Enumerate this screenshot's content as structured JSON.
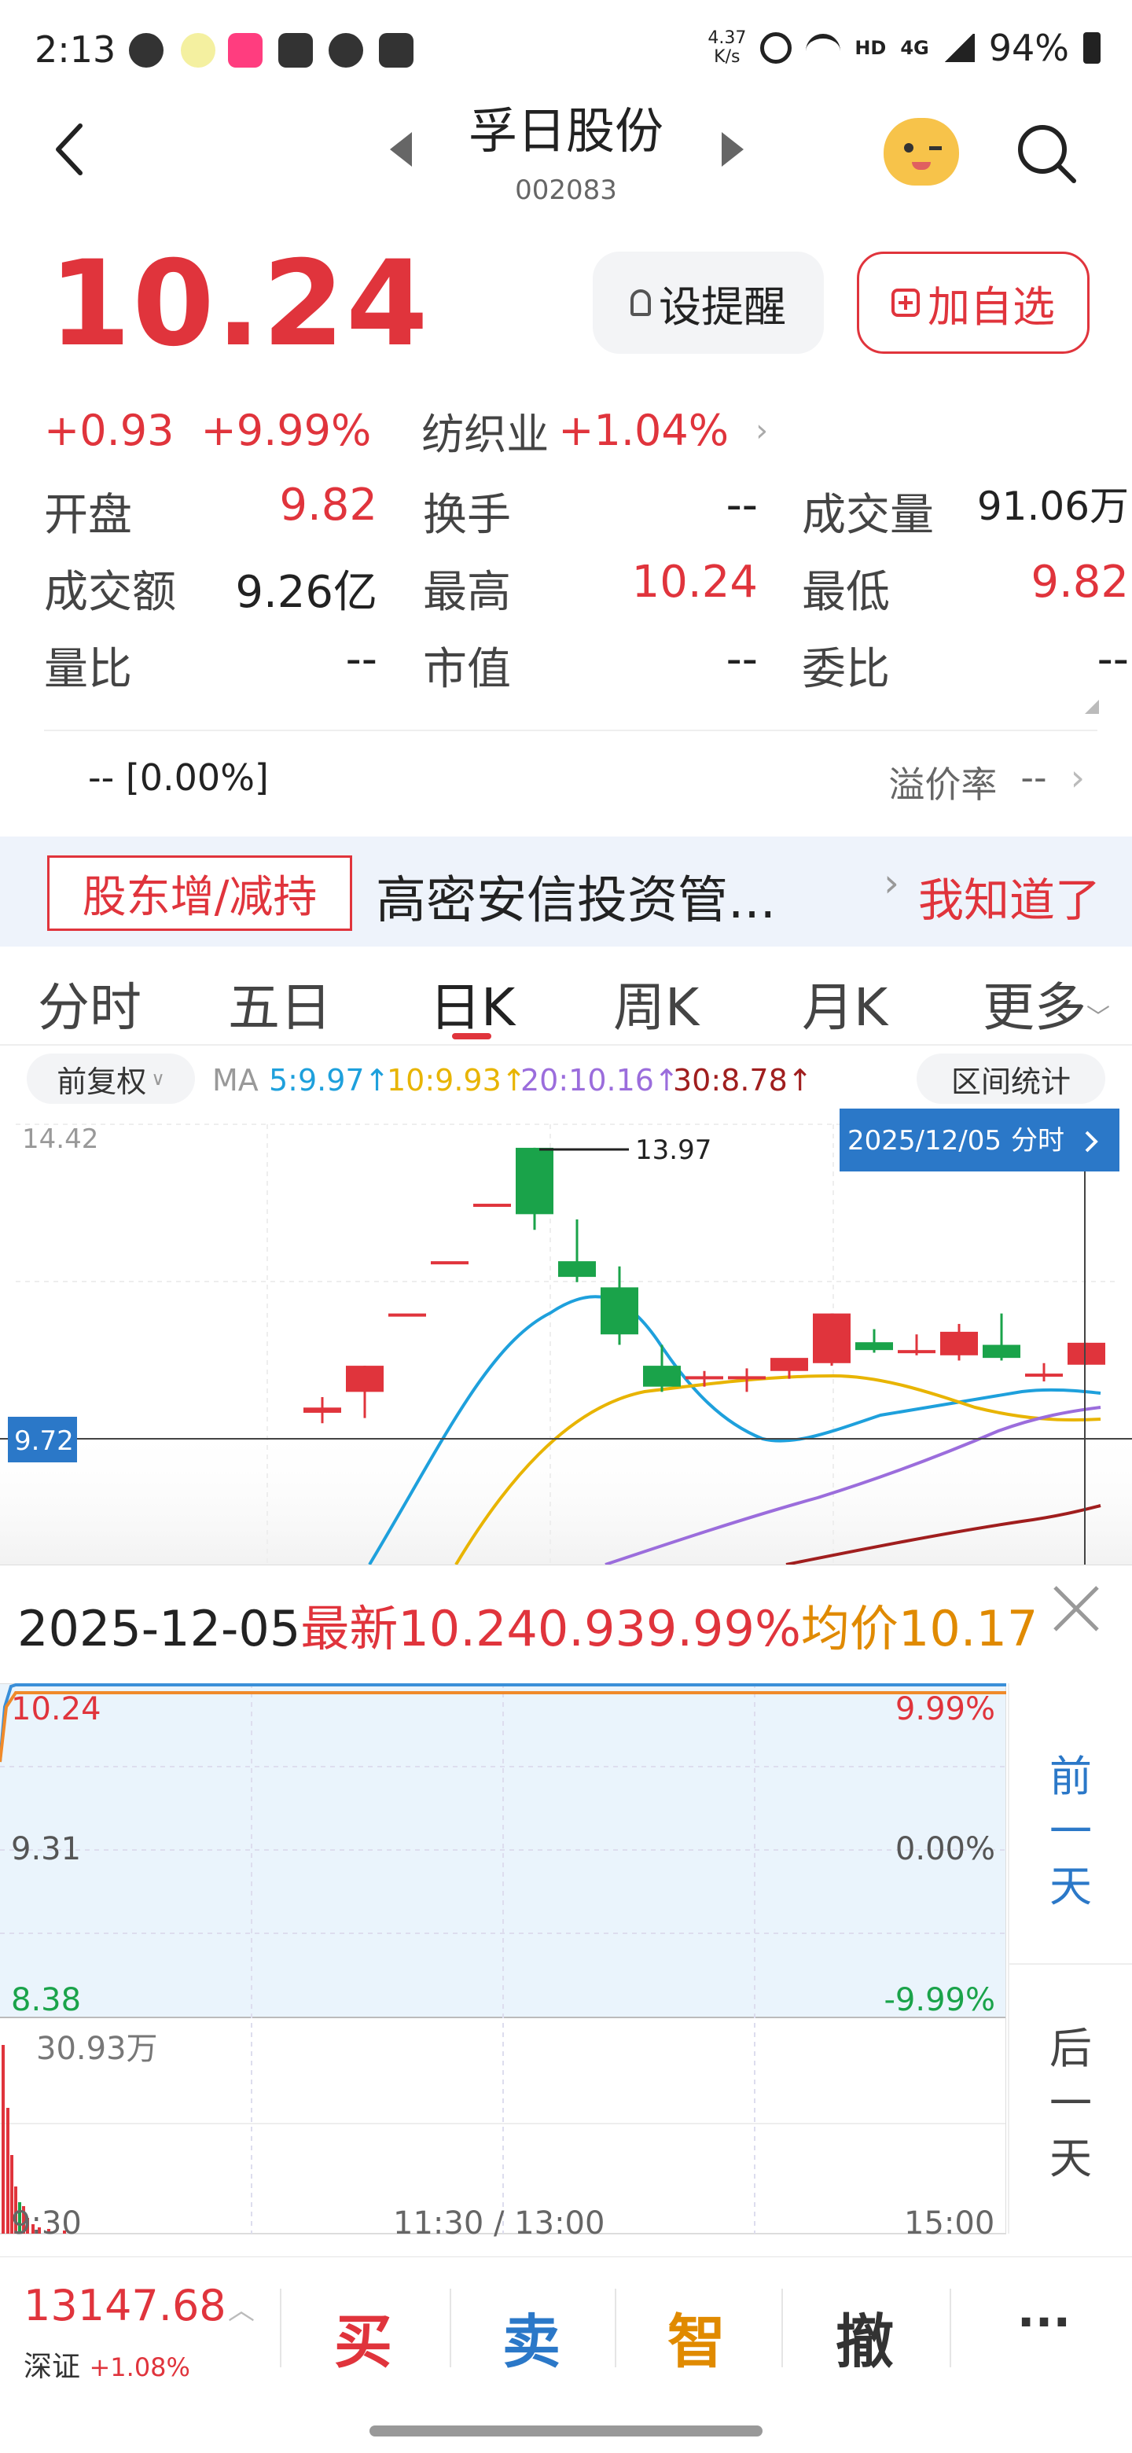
{
  "status_bar": {
    "time": "2:13",
    "net_speed_value": "4.37",
    "net_speed_unit": "K/s",
    "hd_label": "HD",
    "net_label": "4G",
    "battery": "94%"
  },
  "header": {
    "stock_name": "孚日股份",
    "stock_code": "002083"
  },
  "quote": {
    "price": "10.24",
    "alert_label": "设提醒",
    "add_watch_label": "加自选",
    "change": "+0.93",
    "change_pct": "+9.99%",
    "industry": "纺织业",
    "industry_pct": "+1.04%"
  },
  "stats": {
    "open_label": "开盘",
    "open_value": "9.82",
    "turnover_label": "换手",
    "turnover_value": "--",
    "volume_label": "成交量",
    "volume_value": "91.06万",
    "amount_label": "成交额",
    "amount_value": "9.26亿",
    "high_label": "最高",
    "high_value": "10.24",
    "low_label": "最低",
    "low_value": "9.82",
    "vol_ratio_label": "量比",
    "vol_ratio_value": "--",
    "mkt_cap_label": "市值",
    "mkt_cap_value": "--",
    "bid_ratio_label": "委比",
    "bid_ratio_value": "--"
  },
  "premium": {
    "left": "-- [0.00%]",
    "label": "溢价率",
    "value": "--"
  },
  "banner": {
    "tag": "股东增/减持",
    "text": "高密安信投资管...",
    "ack": "我知道了"
  },
  "tabs": [
    "分时",
    "五日",
    "日K",
    "周K",
    "月K",
    "更多"
  ],
  "active_tab": "日K",
  "ma_bar": {
    "adjust": "前复权",
    "ma_label": "MA",
    "ma5": "5:9.97↑",
    "ma10": "10:9.93↑",
    "ma20": "20:10.16↑",
    "ma30": "30:8.78↑",
    "range_stats": "区间统计",
    "colors": {
      "ma5": "#1ea0dc",
      "ma10": "#e8b400",
      "ma20": "#9b6ddc",
      "ma30": "#a01e1e"
    }
  },
  "kchart": {
    "ymax_label": "14.42",
    "peak_label": "13.97",
    "cursor_price": "9.72",
    "date_tag": "2025/12/05",
    "date_tag_link": "分时"
  },
  "chart_data": {
    "type": "candlestick",
    "ylim": [
      7.5,
      14.42
    ],
    "candles": [
      {
        "o": 8.9,
        "h": 9.2,
        "l": 8.7,
        "c": 9.0
      },
      {
        "o": 9.3,
        "h": 9.8,
        "l": 8.8,
        "c": 9.8
      },
      {
        "o": 10.8,
        "h": 10.8,
        "l": 10.8,
        "c": 10.8
      },
      {
        "o": 11.8,
        "h": 11.8,
        "l": 11.8,
        "c": 11.8
      },
      {
        "o": 12.9,
        "h": 12.9,
        "l": 12.9,
        "c": 12.9
      },
      {
        "o": 13.97,
        "h": 13.97,
        "l": 12.4,
        "c": 12.7
      },
      {
        "o": 11.8,
        "h": 12.6,
        "l": 11.4,
        "c": 11.5
      },
      {
        "o": 11.3,
        "h": 11.7,
        "l": 10.2,
        "c": 10.4
      },
      {
        "o": 9.8,
        "h": 10.2,
        "l": 9.3,
        "c": 9.4
      },
      {
        "o": 9.6,
        "h": 9.7,
        "l": 9.4,
        "c": 9.6
      },
      {
        "o": 9.55,
        "h": 9.75,
        "l": 9.3,
        "c": 9.6
      },
      {
        "o": 9.7,
        "h": 9.9,
        "l": 9.55,
        "c": 9.95
      },
      {
        "o": 9.85,
        "h": 10.8,
        "l": 9.8,
        "c": 10.8
      },
      {
        "o": 10.25,
        "h": 10.5,
        "l": 10.05,
        "c": 10.1
      },
      {
        "o": 10.1,
        "h": 10.4,
        "l": 10.0,
        "c": 10.1
      },
      {
        "o": 10.0,
        "h": 10.6,
        "l": 9.9,
        "c": 10.45
      },
      {
        "o": 10.2,
        "h": 10.8,
        "l": 9.9,
        "c": 9.95
      },
      {
        "o": 9.6,
        "h": 9.85,
        "l": 9.5,
        "c": 9.65
      },
      {
        "o": 9.82,
        "h": 10.24,
        "l": 9.82,
        "c": 10.24
      }
    ]
  },
  "intraday": {
    "date": "2025-12-05",
    "latest_label": "最新",
    "latest_value": "10.24",
    "change": "0.93",
    "change_pct": "9.99%",
    "avg_label": "均价",
    "avg_value": "10.17",
    "y_high": "10.24",
    "y_mid": "9.31",
    "y_low": "8.38",
    "pct_high": "9.99%",
    "pct_mid": "0.00%",
    "pct_low": "-9.99%",
    "vol_max": "30.93万",
    "t_start": "9:30",
    "t_mid": "11:30 / 13:00",
    "t_end": "15:00",
    "prev_day": [
      "前",
      "一",
      "天"
    ],
    "next_day": [
      "后",
      "一",
      "天"
    ]
  },
  "bottom_bar": {
    "index_value": "13147.68",
    "index_name": "深证",
    "index_pct": "+1.08%",
    "buy": "买",
    "sell": "卖",
    "smart": "智",
    "cancel": "撤",
    "more": "···"
  }
}
